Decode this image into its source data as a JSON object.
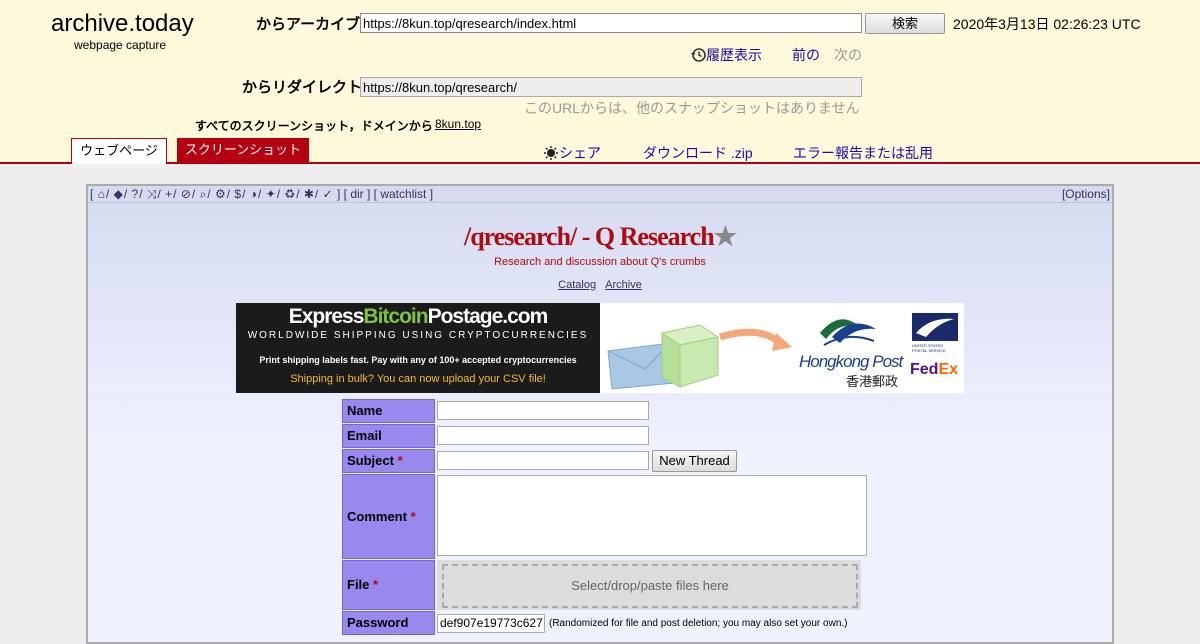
{
  "header": {
    "brand": "archive.today",
    "brand_sub": "webpage capture",
    "archive_label": "からアーカイブ",
    "archive_url": "https://8kun.top/qresearch/index.html",
    "search_button": "検索",
    "timestamp": "2020年3月13日 02:26:23 UTC",
    "history_label": "履歴表示",
    "prev_label": "前の",
    "next_label": "次の",
    "redirect_label": "からリダイレクト",
    "redirect_url": "https://8kun.top/qresearch/",
    "no_snapshots": "このURLからは、他のスナップショットはありません",
    "all_screenshots": "すべてのスクリーンショット，ドメインから",
    "domain": "8kun.top"
  },
  "tabs": {
    "webpage": "ウェブページ",
    "screenshot": "スクリーンショット",
    "share": "シェア",
    "download": "ダウンロード .zip",
    "report": "エラー報告または乱用"
  },
  "board": {
    "topbar_dir": "dir",
    "topbar_watchlist": "watchlist",
    "options": "[Options]",
    "title": "/qresearch/ - Q Research",
    "subtitle": "Research and discussion about Q's crumbs",
    "catalog": "Catalog",
    "archive": "Archive"
  },
  "banner": {
    "brand_part1": "Express",
    "brand_part2": "Bitcoin",
    "brand_part3": "Postage.com",
    "tagline": "WORLDWIDE SHIPPING USING CRYPTOCURRENCIES",
    "line1": "Print shipping labels fast. Pay with any of 100+ accepted cryptocurrencies",
    "line2": "Shipping in bulk? You can now upload your CSV file!",
    "hk_post": "Hongkong Post",
    "hk_post_cn": "香港郵政",
    "usps": "UNITED STATES POSTAL SERVICE",
    "fedex_fe": "Fed",
    "fedex_ex": "Ex"
  },
  "form": {
    "name_label": "Name",
    "email_label": "Email",
    "subject_label": "Subject",
    "comment_label": "Comment",
    "file_label": "File",
    "password_label": "Password",
    "required_mark": "*",
    "new_thread_button": "New Thread",
    "dropzone": "Select/drop/paste files here",
    "password_value": "def907e19773c627",
    "password_hint": "(Randomized for file and post deletion; you may also set your own.)"
  },
  "colors": {
    "archive_bg": "#fff9db",
    "accent_red": "#b40010",
    "board_red": "#af0a0f",
    "form_label_bg": "#9988ee"
  }
}
